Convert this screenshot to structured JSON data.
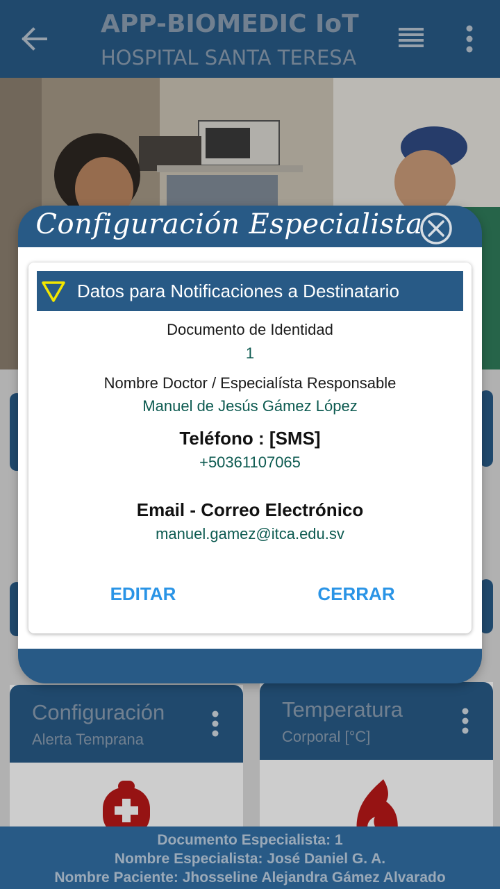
{
  "appbar": {
    "title": "APP-BIOMEDIC IoT",
    "subtitle": "HOSPITAL SANTA TERESA",
    "icons": [
      "arrow-back-icon",
      "list-icon",
      "more-vert-icon"
    ]
  },
  "cards": [
    {
      "title": "Configuración",
      "subtitle": "Alerta Temprana",
      "icon": "medical-kit-icon"
    },
    {
      "title": "Temperatura",
      "subtitle": "Corporal [°C]",
      "icon": "flame-icon"
    }
  ],
  "dialog": {
    "title": "Configuración Especialista",
    "section_title": "Datos para Notificaciones a Destinatario",
    "fields": {
      "document_label": "Documento de Identidad",
      "document_value": "1",
      "doctor_label": "Nombre Doctor / Especialísta Responsable",
      "doctor_value": "Manuel de Jesús Gámez López",
      "phone_label": "Teléfono : [SMS]",
      "phone_value": "+50361107065",
      "email_label": "Email - Correo Electrónico",
      "email_value": "manuel.gamez@itca.edu.sv"
    },
    "buttons": {
      "edit": "EDITAR",
      "close": "CERRAR"
    }
  },
  "footer": {
    "line1": "Documento Especialista: 1",
    "line2": "Nombre Especialista: José Daniel G. A.",
    "line3": "Nombre Paciente: Jhosseline Alejandra Gámez Alvarado"
  },
  "colors": {
    "primary": "#285a86",
    "accent_button": "#2a94e6",
    "value_text": "#0c5a50",
    "warning_triangle": "#f2e600",
    "icon_red": "#b81818"
  }
}
